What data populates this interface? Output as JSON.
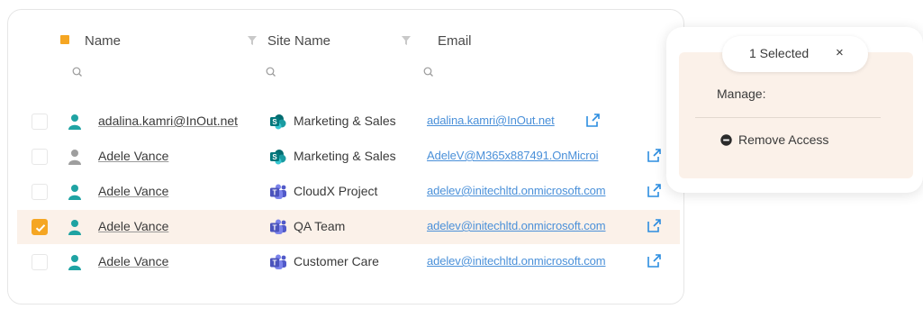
{
  "table": {
    "columns": {
      "name": "Name",
      "site_name": "Site Name",
      "email": "Email"
    },
    "rows": [
      {
        "name": "adalina.kamri@InOut.net",
        "site": "Marketing & Sales",
        "site_icon": "sharepoint-icon",
        "email": "adalina.kamri@InOut.net",
        "user_type": "member",
        "selected": false
      },
      {
        "name": "Adele Vance",
        "site": "Marketing & Sales",
        "site_icon": "sharepoint-icon",
        "email": "AdeleV@M365x887491.OnMicroi",
        "user_type": "guest",
        "selected": false
      },
      {
        "name": "Adele Vance",
        "site": "CloudX Project",
        "site_icon": "teams-icon",
        "email": "adelev@initechltd.onmicrosoft.com",
        "user_type": "member",
        "selected": false
      },
      {
        "name": "Adele Vance",
        "site": "QA Team",
        "site_icon": "teams-icon",
        "email": "adelev@initechltd.onmicrosoft.com",
        "user_type": "member",
        "selected": true
      },
      {
        "name": "Adele Vance",
        "site": "Customer Care",
        "site_icon": "teams-icon",
        "email": "adelev@initechltd.onmicrosoft.com",
        "user_type": "member",
        "selected": false
      }
    ]
  },
  "panel": {
    "selected_label": "1 Selected",
    "close_symbol": "×",
    "manage_label": "Manage:",
    "remove_access_label": "Remove Access"
  },
  "colors": {
    "accent": "#f5a623",
    "link": "#4a90d9",
    "member_user": "#1fa3a3",
    "guest_user": "#9e9e9e",
    "selected_row_bg": "#fbf1e9"
  }
}
